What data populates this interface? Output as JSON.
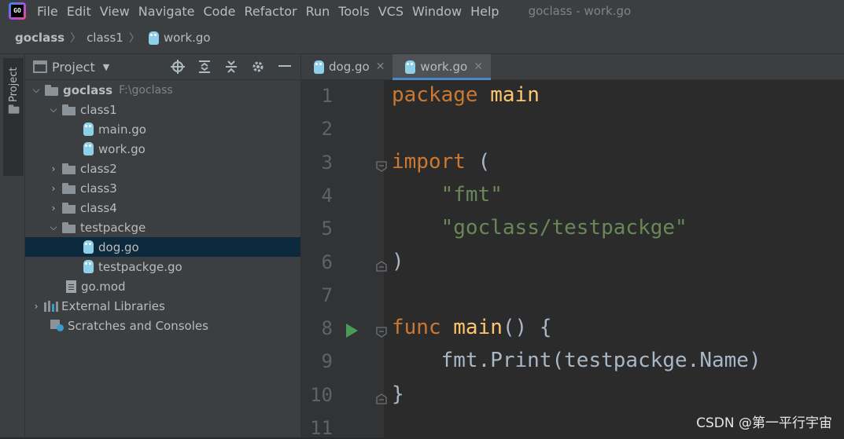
{
  "menubar": {
    "items": [
      "File",
      "Edit",
      "View",
      "Navigate",
      "Code",
      "Refactor",
      "Run",
      "Tools",
      "VCS",
      "Window",
      "Help"
    ],
    "window_title": "goclass - work.go",
    "logo_text": "GO"
  },
  "breadcrumb": {
    "items": [
      "goclass",
      "class1",
      "work.go"
    ]
  },
  "tool_strip": {
    "project_label": "Project"
  },
  "project_panel": {
    "title": "Project",
    "tree": {
      "root": {
        "label": "goclass",
        "path": "F:\\goclass"
      },
      "class1": "class1",
      "main_go": "main.go",
      "work_go": "work.go",
      "class2": "class2",
      "class3": "class3",
      "class4": "class4",
      "testpackge": "testpackge",
      "dog_go": "dog.go",
      "testpackge_go": "testpackge.go",
      "go_mod": "go.mod",
      "external_libraries": "External Libraries",
      "scratches": "Scratches and Consoles"
    }
  },
  "editor": {
    "tabs": [
      {
        "label": "dog.go",
        "active": false
      },
      {
        "label": "work.go",
        "active": true
      }
    ],
    "lines": [
      {
        "num": "1",
        "tokens": [
          {
            "t": "package ",
            "c": "kw"
          },
          {
            "t": "main",
            "c": "fn"
          }
        ]
      },
      {
        "num": "2",
        "tokens": []
      },
      {
        "num": "3",
        "tokens": [
          {
            "t": "import",
            "c": "kw"
          },
          {
            "t": " (",
            "c": ""
          }
        ]
      },
      {
        "num": "4",
        "tokens": [
          {
            "t": "    ",
            "c": ""
          },
          {
            "t": "\"fmt\"",
            "c": "str"
          }
        ]
      },
      {
        "num": "5",
        "tokens": [
          {
            "t": "    ",
            "c": ""
          },
          {
            "t": "\"goclass/testpackge\"",
            "c": "str"
          }
        ]
      },
      {
        "num": "6",
        "tokens": [
          {
            "t": ")",
            "c": ""
          }
        ]
      },
      {
        "num": "7",
        "tokens": []
      },
      {
        "num": "8",
        "tokens": [
          {
            "t": "func ",
            "c": "kw"
          },
          {
            "t": "main",
            "c": "fn"
          },
          {
            "t": "() {",
            "c": ""
          }
        ]
      },
      {
        "num": "9",
        "tokens": [
          {
            "t": "    fmt.Print(testpackge.Name)",
            "c": ""
          }
        ]
      },
      {
        "num": "10",
        "tokens": [
          {
            "t": "}",
            "c": ""
          }
        ]
      },
      {
        "num": "11",
        "tokens": []
      }
    ]
  },
  "watermark": "CSDN @第一平行宇宙",
  "colors": {
    "keyword": "#cc7832",
    "string": "#6a8759",
    "function": "#ffc66d",
    "selection": "#0d293e",
    "run_icon": "#499c54"
  }
}
